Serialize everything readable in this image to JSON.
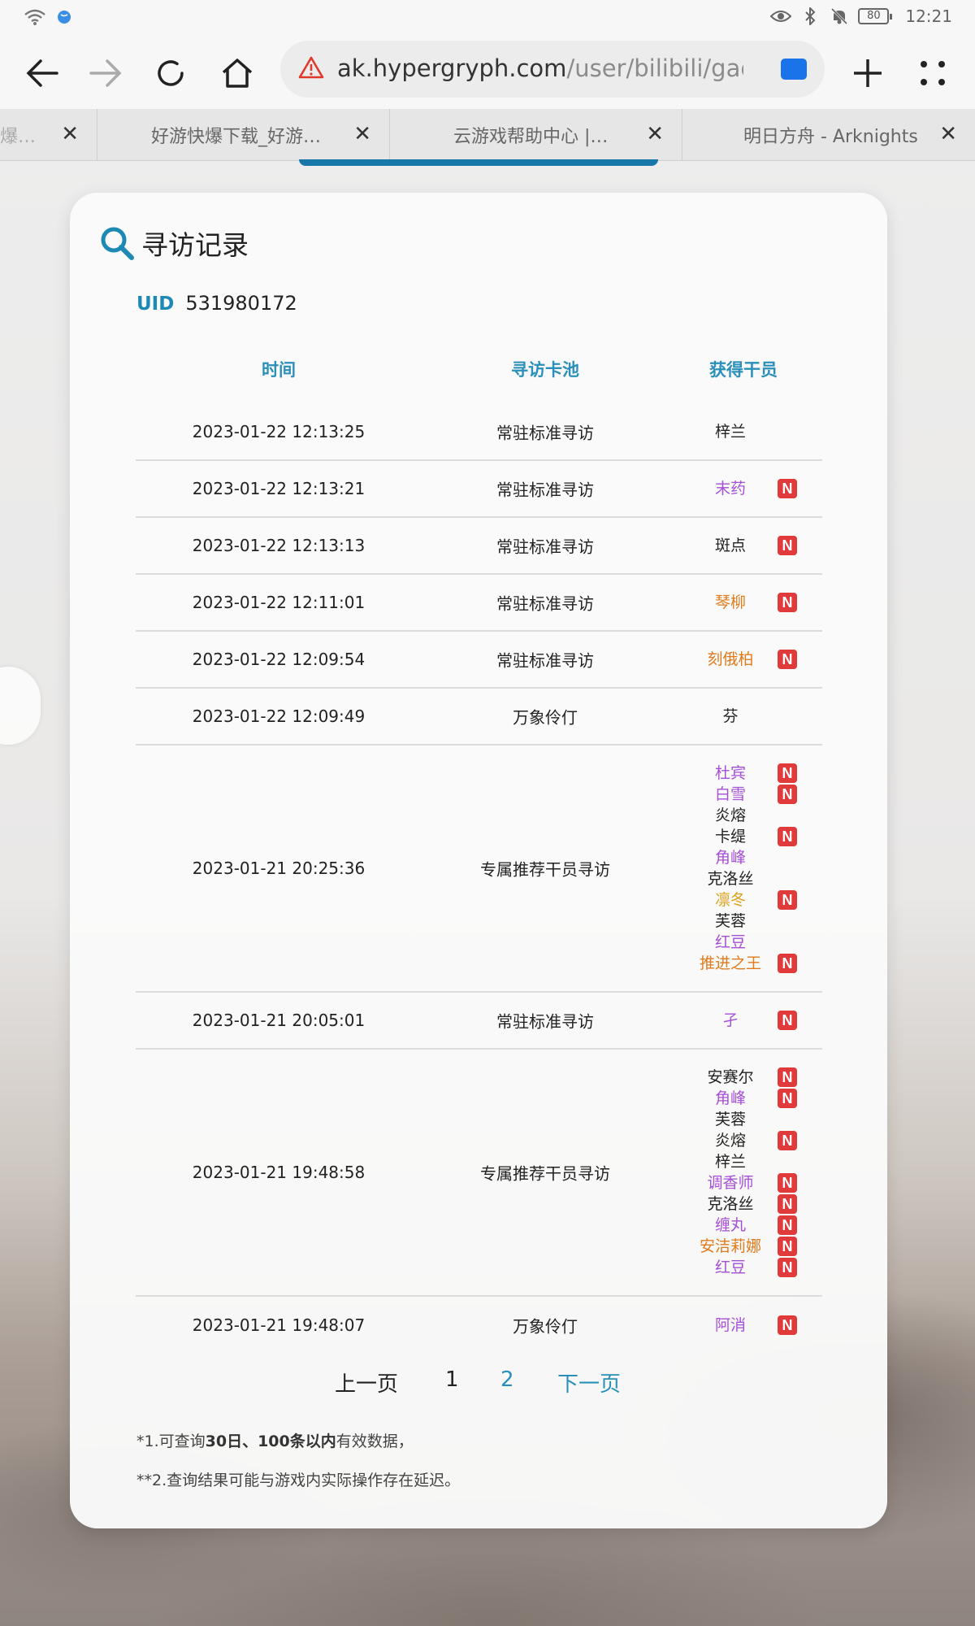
{
  "status_bar": {
    "battery": "80",
    "time": "12:21"
  },
  "browser": {
    "url_domain": "ak.hypergryph.com",
    "url_path": "/user/bilibili/gacha",
    "tabs": [
      {
        "label": "爆…"
      },
      {
        "label": "好游快爆下载_好游…"
      },
      {
        "label": "云游戏帮助中心 |…"
      },
      {
        "label": "明日方舟 - Arknights"
      }
    ]
  },
  "card": {
    "title": "寻访记录",
    "uid_label": "UID",
    "uid_value": "531980172",
    "columns": [
      "时间",
      "寻访卡池",
      "获得干员"
    ],
    "rows": [
      {
        "time": "2023-01-22 12:13:25",
        "pool": "常驻标准寻访",
        "ops": [
          {
            "name": "梓兰",
            "color": "#222222",
            "new": false
          }
        ]
      },
      {
        "time": "2023-01-22 12:13:21",
        "pool": "常驻标准寻访",
        "ops": [
          {
            "name": "末药",
            "color": "#a64fd6",
            "new": true
          }
        ]
      },
      {
        "time": "2023-01-22 12:13:13",
        "pool": "常驻标准寻访",
        "ops": [
          {
            "name": "斑点",
            "color": "#222222",
            "new": true
          }
        ]
      },
      {
        "time": "2023-01-22 12:11:01",
        "pool": "常驻标准寻访",
        "ops": [
          {
            "name": "琴柳",
            "color": "#e07a1c",
            "new": true
          }
        ]
      },
      {
        "time": "2023-01-22 12:09:54",
        "pool": "常驻标准寻访",
        "ops": [
          {
            "name": "刻俄柏",
            "color": "#e07a1c",
            "new": true
          }
        ]
      },
      {
        "time": "2023-01-22 12:09:49",
        "pool": "万象伶仃",
        "ops": [
          {
            "name": "芬",
            "color": "#222222",
            "new": false
          }
        ]
      },
      {
        "time": "2023-01-21 20:25:36",
        "pool": "专属推荐干员寻访",
        "ops": [
          {
            "name": "杜宾",
            "color": "#a64fd6",
            "new": true
          },
          {
            "name": "白雪",
            "color": "#a64fd6",
            "new": true
          },
          {
            "name": "炎熔",
            "color": "#222222",
            "new": false
          },
          {
            "name": "卡缇",
            "color": "#222222",
            "new": true
          },
          {
            "name": "角峰",
            "color": "#a64fd6",
            "new": false
          },
          {
            "name": "克洛丝",
            "color": "#222222",
            "new": false
          },
          {
            "name": "凛冬",
            "color": "#d9a21b",
            "new": true
          },
          {
            "name": "芙蓉",
            "color": "#222222",
            "new": false
          },
          {
            "name": "红豆",
            "color": "#a64fd6",
            "new": false
          },
          {
            "name": "推进之王",
            "color": "#e07a1c",
            "new": true
          }
        ]
      },
      {
        "time": "2023-01-21 20:05:01",
        "pool": "常驻标准寻访",
        "ops": [
          {
            "name": "孑",
            "color": "#a64fd6",
            "new": true
          }
        ]
      },
      {
        "time": "2023-01-21 19:48:58",
        "pool": "专属推荐干员寻访",
        "ops": [
          {
            "name": "安赛尔",
            "color": "#222222",
            "new": true
          },
          {
            "name": "角峰",
            "color": "#a64fd6",
            "new": true
          },
          {
            "name": "芙蓉",
            "color": "#222222",
            "new": false
          },
          {
            "name": "炎熔",
            "color": "#222222",
            "new": true
          },
          {
            "name": "梓兰",
            "color": "#222222",
            "new": false
          },
          {
            "name": "调香师",
            "color": "#a64fd6",
            "new": true
          },
          {
            "name": "克洛丝",
            "color": "#222222",
            "new": true
          },
          {
            "name": "缠丸",
            "color": "#a64fd6",
            "new": true
          },
          {
            "name": "安洁莉娜",
            "color": "#e07a1c",
            "new": true
          },
          {
            "name": "红豆",
            "color": "#a64fd6",
            "new": true
          }
        ]
      },
      {
        "time": "2023-01-21 19:48:07",
        "pool": "万象伶仃",
        "ops": [
          {
            "name": "阿消",
            "color": "#a64fd6",
            "new": true
          }
        ]
      }
    ],
    "new_badge": "N",
    "pager": {
      "prev": "上一页",
      "page1": "1",
      "page2": "2",
      "next": "下一页",
      "current_color": "#2a90b9"
    },
    "notes": {
      "line1_prefix": "*1.可查询",
      "line1_bold": "30日、100条以内",
      "line1_suffix": "有效数据，",
      "line2": "**2.查询结果可能与游戏内实际操作存在延迟。"
    }
  }
}
